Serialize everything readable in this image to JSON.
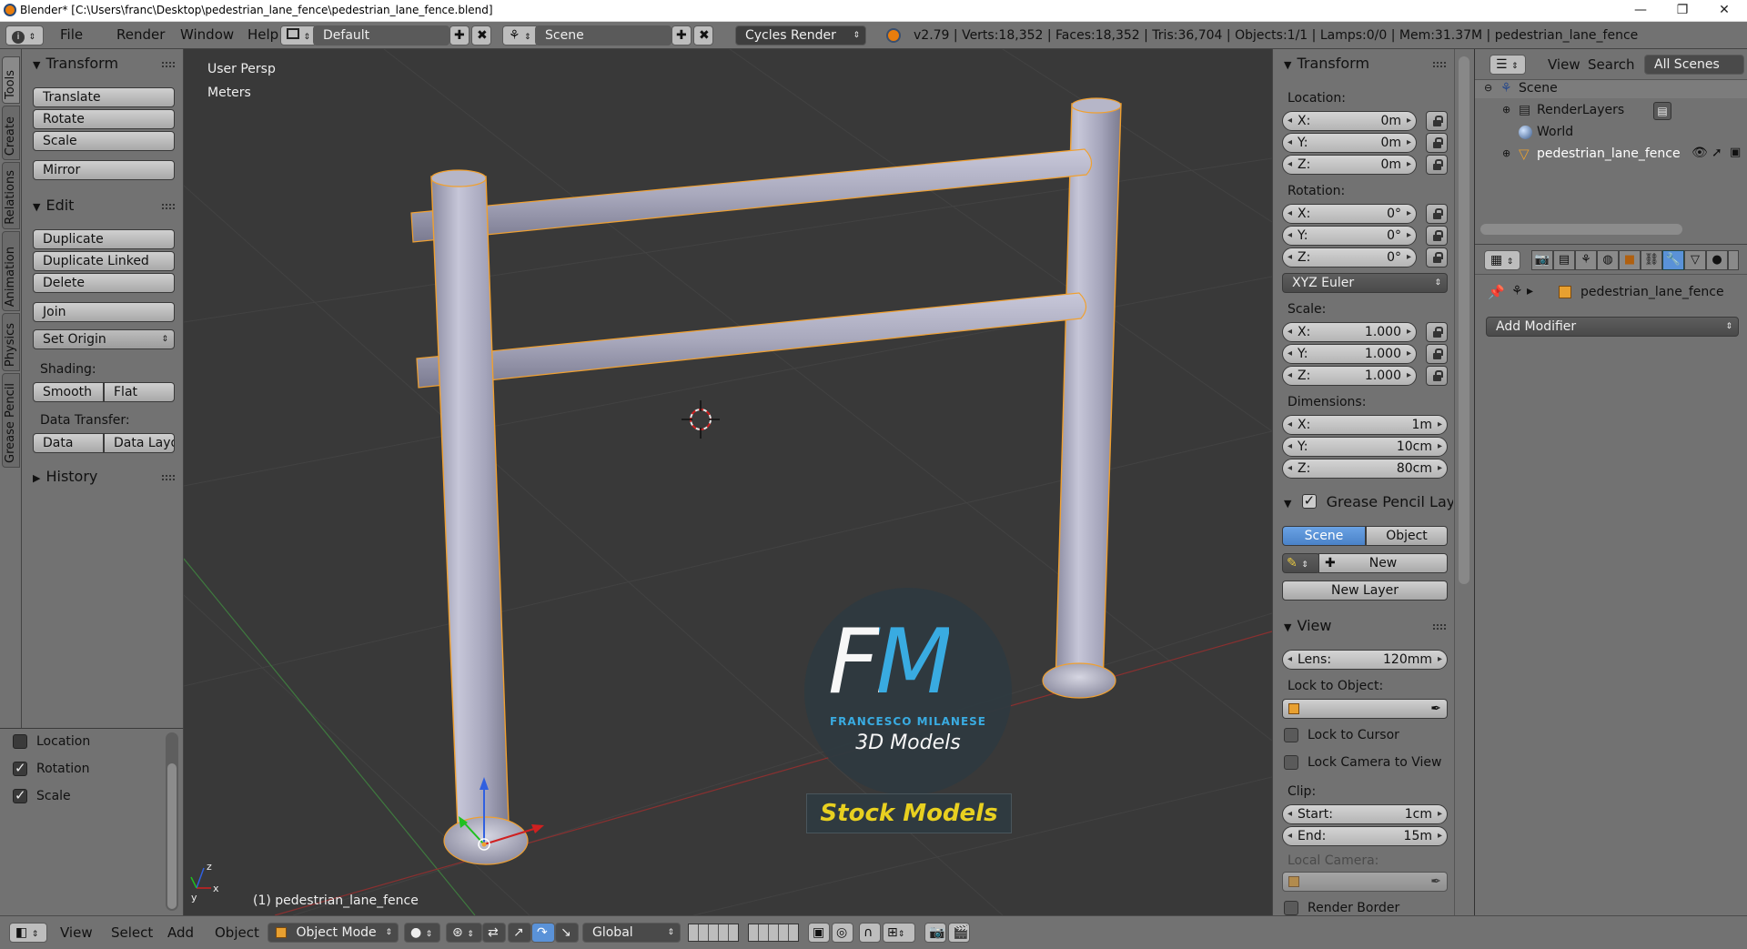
{
  "window": {
    "title": "Blender* [C:\\Users\\franc\\Desktop\\pedestrian_lane_fence\\pedestrian_lane_fence.blend]",
    "minimize": "—",
    "maximize": "❐",
    "close": "✕"
  },
  "topbar": {
    "menus": [
      "File",
      "Render",
      "Window",
      "Help"
    ],
    "layout": "Default",
    "scene": "Scene",
    "engine": "Cycles Render",
    "stats": "v2.79 | Verts:18,352 | Faces:18,352 | Tris:36,704 | Objects:1/1 | Lamps:0/0 | Mem:31.37M | pedestrian_lane_fence"
  },
  "vtabs": [
    "Tools",
    "Create",
    "Relations",
    "Animation",
    "Physics",
    "Grease Pencil"
  ],
  "toolshelf": {
    "transform_header": "Transform",
    "translate": "Translate",
    "rotate": "Rotate",
    "scale": "Scale",
    "mirror": "Mirror",
    "edit_header": "Edit",
    "duplicate": "Duplicate",
    "duplicate_linked": "Duplicate Linked",
    "delete": "Delete",
    "join": "Join",
    "set_origin": "Set Origin",
    "shading_label": "Shading:",
    "smooth": "Smooth",
    "flat": "Flat",
    "data_transfer_label": "Data Transfer:",
    "data": "Data",
    "data_layout": "Data Layo",
    "history_header": "History"
  },
  "redo_panel": {
    "location": "Location",
    "rotation": "Rotation",
    "scale": "Scale",
    "location_checked": false,
    "rotation_checked": true,
    "scale_checked": true
  },
  "viewport": {
    "view_name": "User Persp",
    "units": "Meters",
    "object_label": "(1) pedestrian_lane_fence",
    "watermark": {
      "fm": "FM",
      "name": "FRANCESCO MILANESE",
      "tagline": "3D Models",
      "stock": "Stock Models"
    }
  },
  "npanel": {
    "transform_header": "Transform",
    "location_label": "Location:",
    "loc": [
      {
        "axis": "X:",
        "value": "0m"
      },
      {
        "axis": "Y:",
        "value": "0m"
      },
      {
        "axis": "Z:",
        "value": "0m"
      }
    ],
    "rotation_label": "Rotation:",
    "rot": [
      {
        "axis": "X:",
        "value": "0°"
      },
      {
        "axis": "Y:",
        "value": "0°"
      },
      {
        "axis": "Z:",
        "value": "0°"
      }
    ],
    "rotation_mode": "XYZ Euler",
    "scale_label": "Scale:",
    "scl": [
      {
        "axis": "X:",
        "value": "1.000"
      },
      {
        "axis": "Y:",
        "value": "1.000"
      },
      {
        "axis": "Z:",
        "value": "1.000"
      }
    ],
    "dimensions_label": "Dimensions:",
    "dim": [
      {
        "axis": "X:",
        "value": "1m"
      },
      {
        "axis": "Y:",
        "value": "10cm"
      },
      {
        "axis": "Z:",
        "value": "80cm"
      }
    ],
    "gp_header": "Grease Pencil Layer",
    "gp_scene": "Scene",
    "gp_object": "Object",
    "gp_new": "New",
    "gp_new_layer": "New Layer",
    "view_header": "View",
    "lens_label": "Lens:",
    "lens_value": "120mm",
    "lock_object_label": "Lock to Object:",
    "lock_cursor": "Lock to Cursor",
    "lock_camera": "Lock Camera to View",
    "clip_label": "Clip:",
    "clip_start_label": "Start:",
    "clip_start": "1cm",
    "clip_end_label": "End:",
    "clip_end": "15m",
    "local_camera_label": "Local Camera:",
    "render_border": "Render Border"
  },
  "outliner": {
    "view": "View",
    "search": "Search",
    "filter": "All Scenes",
    "items": [
      {
        "name": "Scene"
      },
      {
        "name": "RenderLayers"
      },
      {
        "name": "World"
      },
      {
        "name": "pedestrian_lane_fence"
      }
    ]
  },
  "properties": {
    "object_name": "pedestrian_lane_fence",
    "add_modifier": "Add Modifier"
  },
  "bottombar": {
    "menus": [
      "View",
      "Select",
      "Add",
      "Object"
    ],
    "mode": "Object Mode",
    "orientation": "Global"
  },
  "colors": {
    "panel": "#727272",
    "viewport": "#393939",
    "selection_outline": "#f0a030",
    "accent_blue": "#5a92d8"
  }
}
